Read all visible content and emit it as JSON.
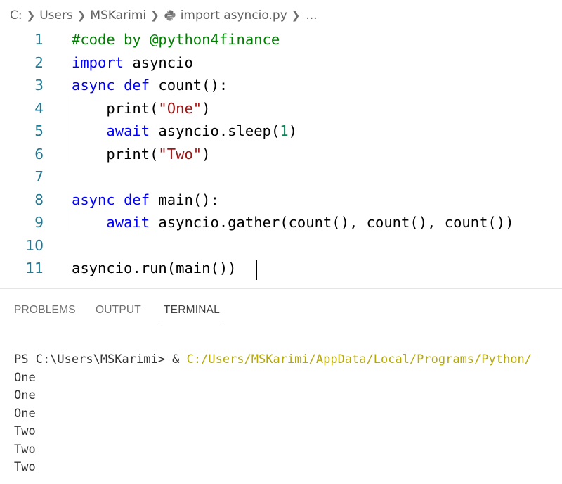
{
  "breadcrumb": {
    "items": [
      "C:",
      "Users",
      "MSKarimi",
      "import asyncio.py",
      "..."
    ],
    "icons": {
      "separator": "chevron-right-icon",
      "file": "python-file-icon"
    }
  },
  "editor": {
    "lines": [
      {
        "number": "1",
        "tokens": [
          {
            "t": "#code by @python4finance",
            "c": "comment"
          }
        ]
      },
      {
        "number": "2",
        "tokens": [
          {
            "t": "import",
            "c": "keyword"
          },
          {
            "t": " asyncio",
            "c": "plain"
          }
        ]
      },
      {
        "number": "3",
        "tokens": [
          {
            "t": "async",
            "c": "keyword"
          },
          {
            "t": " ",
            "c": "plain"
          },
          {
            "t": "def",
            "c": "keyword"
          },
          {
            "t": " count():",
            "c": "plain"
          }
        ]
      },
      {
        "number": "4",
        "tokens": [
          {
            "t": "    print(",
            "c": "plain"
          },
          {
            "t": "\"One\"",
            "c": "string"
          },
          {
            "t": ")",
            "c": "plain"
          }
        ]
      },
      {
        "number": "5",
        "tokens": [
          {
            "t": "    ",
            "c": "plain"
          },
          {
            "t": "await",
            "c": "keyword"
          },
          {
            "t": " asyncio.sleep(",
            "c": "plain"
          },
          {
            "t": "1",
            "c": "number"
          },
          {
            "t": ")",
            "c": "plain"
          }
        ]
      },
      {
        "number": "6",
        "tokens": [
          {
            "t": "    print(",
            "c": "plain"
          },
          {
            "t": "\"Two\"",
            "c": "string"
          },
          {
            "t": ")",
            "c": "plain"
          }
        ]
      },
      {
        "number": "7",
        "tokens": []
      },
      {
        "number": "8",
        "tokens": [
          {
            "t": "async",
            "c": "keyword"
          },
          {
            "t": " ",
            "c": "plain"
          },
          {
            "t": "def",
            "c": "keyword"
          },
          {
            "t": " main():",
            "c": "plain"
          }
        ]
      },
      {
        "number": "9",
        "tokens": [
          {
            "t": "    ",
            "c": "plain"
          },
          {
            "t": "await",
            "c": "keyword"
          },
          {
            "t": " asyncio.gather(count(), count(), count())",
            "c": "plain"
          }
        ]
      },
      {
        "number": "10",
        "tokens": []
      },
      {
        "number": "11",
        "tokens": [
          {
            "t": "asyncio.run(main())",
            "c": "plain"
          }
        ]
      }
    ],
    "colors": {
      "keyword": "#0000ff",
      "comment": "#008000",
      "string": "#a31515",
      "number": "#098658",
      "line_number": "#237893"
    }
  },
  "panel": {
    "tabs": [
      {
        "label": "PROBLEMS",
        "active": false
      },
      {
        "label": "OUTPUT",
        "active": false
      },
      {
        "label": "TERMINAL",
        "active": true
      }
    ]
  },
  "terminal": {
    "prompt": "PS C:\\Users\\MSKarimi> & ",
    "command_path": "C:/Users/MSKarimi/AppData/Local/Programs/Python/",
    "output": [
      "One",
      "One",
      "One",
      "Two",
      "Two",
      "Two"
    ],
    "path_color": "#b5a80a"
  }
}
